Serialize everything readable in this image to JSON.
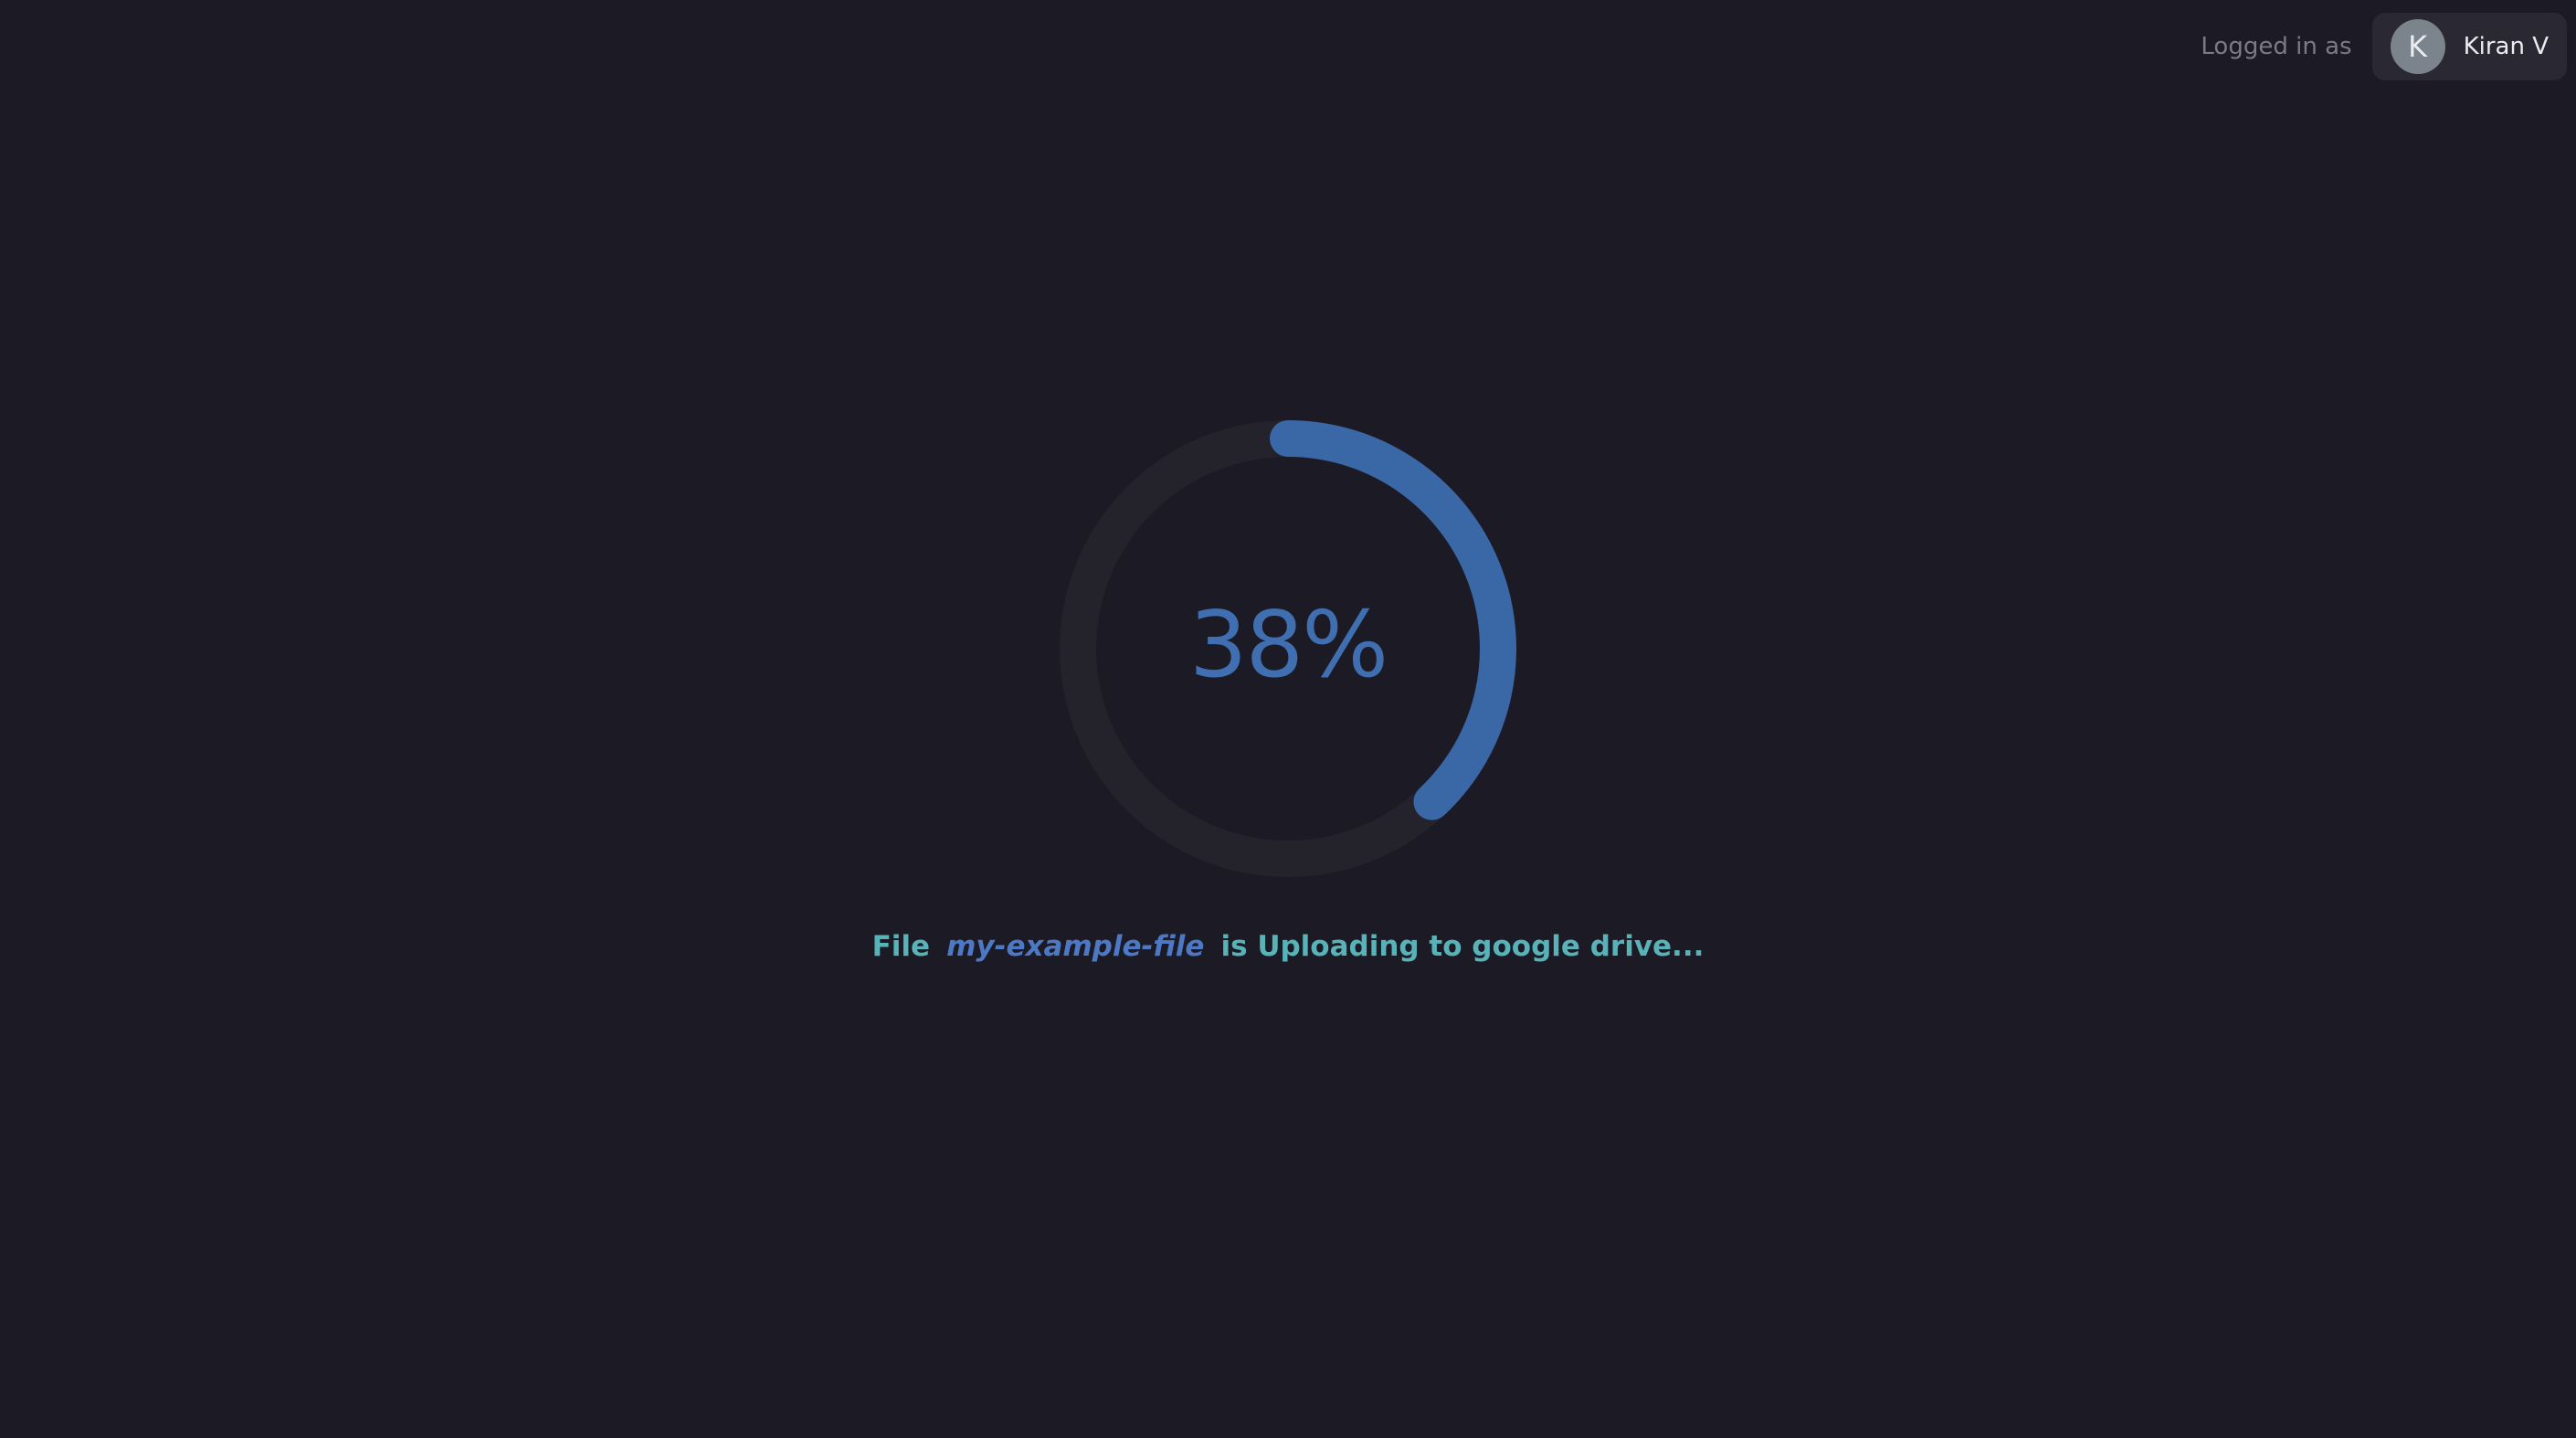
{
  "header": {
    "logged_in_label": "Logged in as",
    "user": {
      "avatar_initial": "K",
      "name": "Kiran V"
    }
  },
  "upload": {
    "progress_percent": 38,
    "progress_label": "38%",
    "status_prefix": "File",
    "file_name": "my-example-file",
    "status_suffix": "is Uploading to google drive..."
  },
  "colors": {
    "background": "#1c1a24",
    "ring_track": "#24222b",
    "ring_progress": "#3a67a6",
    "percent_text": "#3f6fb0",
    "status_text": "#58b3b8",
    "file_name_text": "#4c78c4"
  },
  "icons": {
    "progress": "circular-progress-ring"
  }
}
